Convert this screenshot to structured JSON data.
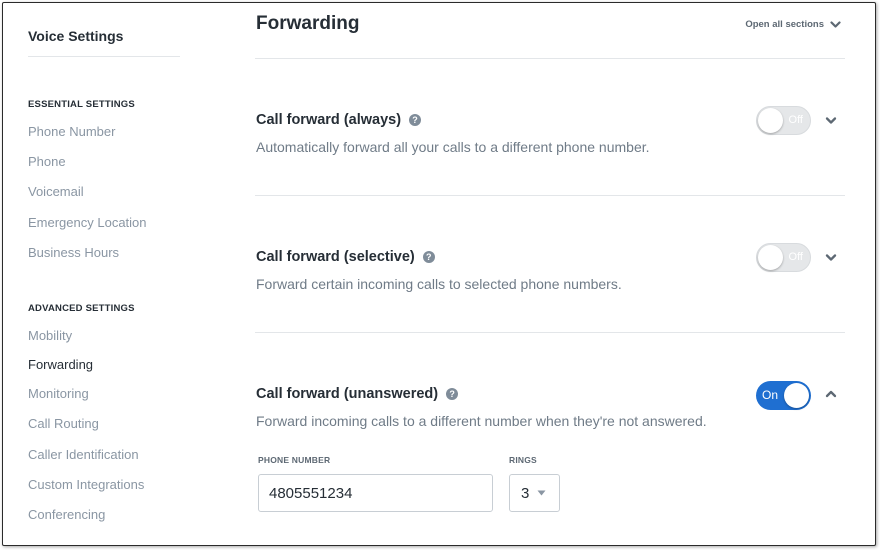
{
  "sidebar": {
    "title": "Voice Settings",
    "sections": [
      {
        "heading": "ESSENTIAL SETTINGS",
        "items": [
          "Phone Number",
          "Phone",
          "Voicemail",
          "Emergency Location",
          "Business Hours"
        ]
      },
      {
        "heading": "ADVANCED SETTINGS",
        "items": [
          "Mobility",
          "Forwarding",
          "Monitoring",
          "Call Routing",
          "Caller Identification",
          "Custom Integrations",
          "Conferencing"
        ]
      }
    ],
    "active_item": "Forwarding"
  },
  "main": {
    "title": "Forwarding",
    "open_all_label": "Open all sections",
    "sections": [
      {
        "title": "Call forward (always)",
        "description": "Automatically forward all your calls to a different phone number.",
        "toggle_label": "Off",
        "toggle_state": "off",
        "expanded": false
      },
      {
        "title": "Call forward (selective)",
        "description": "Forward certain incoming calls to selected phone numbers.",
        "toggle_label": "Off",
        "toggle_state": "off",
        "expanded": false
      },
      {
        "title": "Call forward (unanswered)",
        "description": "Forward incoming calls to a different number when they're not answered.",
        "toggle_label": "On",
        "toggle_state": "on",
        "expanded": true,
        "phone_number_label": "PHONE NUMBER",
        "phone_number_value": "4805551234",
        "rings_label": "RINGS",
        "rings_value": "3"
      }
    ]
  },
  "colors": {
    "accent": "#1f6fd1",
    "muted_text": "#8a96a3",
    "heading_text": "#262e36"
  },
  "icons": {
    "help": "question-circle-icon",
    "chevron_down": "chevron-down-icon",
    "chevron_up": "chevron-up-icon",
    "dropdown": "caret-down-icon"
  }
}
